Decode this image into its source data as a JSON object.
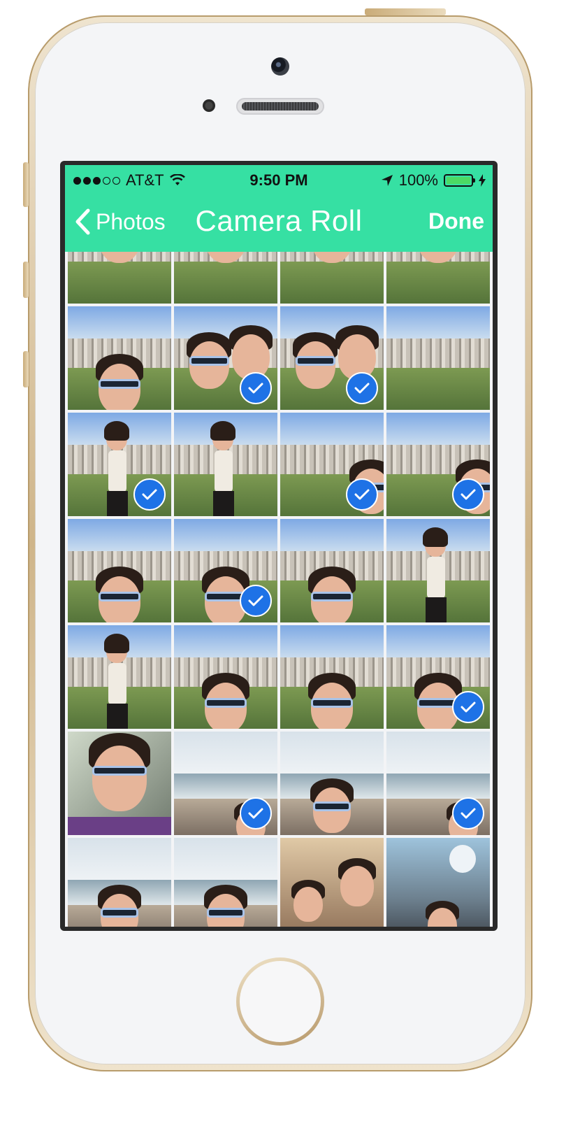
{
  "status_bar": {
    "carrier": "AT&T",
    "signal_bars": 3,
    "signal_total": 5,
    "time": "9:50 PM",
    "battery": "100%"
  },
  "nav": {
    "back_label": "Photos",
    "title": "Camera Roll",
    "done_label": "Done"
  },
  "colors": {
    "accent": "#36e0a3",
    "check": "#1e72e6"
  },
  "icons": [
    "wifi-icon",
    "location-arrow-icon",
    "battery-icon",
    "charging-icon",
    "chevron-left-icon",
    "checkmark-icon"
  ],
  "photos": [
    {
      "kind": "selfie",
      "checked": false
    },
    {
      "kind": "selfie",
      "checked": false
    },
    {
      "kind": "selfie",
      "checked": false
    },
    {
      "kind": "selfie",
      "checked": false
    },
    {
      "kind": "selfie-low",
      "checked": false
    },
    {
      "kind": "duo",
      "checked": true
    },
    {
      "kind": "duo",
      "checked": true
    },
    {
      "kind": "landscape",
      "checked": false
    },
    {
      "kind": "people",
      "checked": true
    },
    {
      "kind": "people",
      "checked": false
    },
    {
      "kind": "landscape-edge",
      "checked": true
    },
    {
      "kind": "landscape-edge",
      "checked": true
    },
    {
      "kind": "selfie-low",
      "checked": false
    },
    {
      "kind": "selfie-low",
      "checked": true
    },
    {
      "kind": "selfie-low",
      "checked": false
    },
    {
      "kind": "people",
      "checked": false
    },
    {
      "kind": "people",
      "checked": false
    },
    {
      "kind": "selfie-low",
      "checked": false
    },
    {
      "kind": "selfie-low",
      "checked": false
    },
    {
      "kind": "selfie-low",
      "checked": true
    },
    {
      "kind": "car",
      "checked": false
    },
    {
      "kind": "beach",
      "checked": true
    },
    {
      "kind": "beach-selfie",
      "checked": false
    },
    {
      "kind": "beach",
      "checked": true
    },
    {
      "kind": "beach-selfie",
      "checked": false
    },
    {
      "kind": "beach-selfie",
      "checked": false
    },
    {
      "kind": "indoor",
      "checked": false
    },
    {
      "kind": "store",
      "checked": false
    }
  ]
}
